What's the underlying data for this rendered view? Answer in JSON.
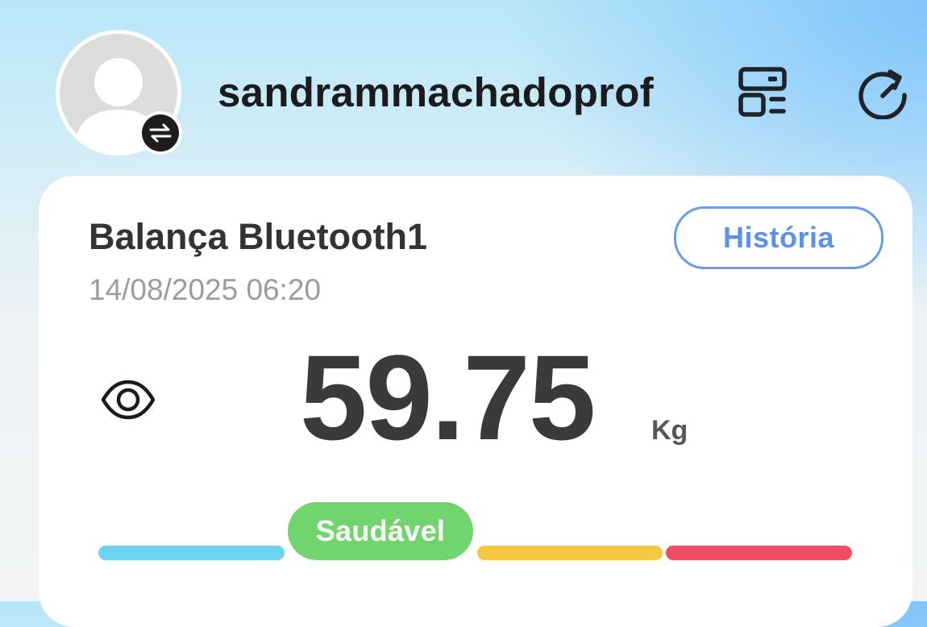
{
  "header": {
    "username": "sandrammachadoprof",
    "avatar_icon": "default-user-avatar-icon",
    "switch_icon": "switch-arrows-icon",
    "device_icon": "device-list-icon",
    "refresh_icon": "refresh-icon"
  },
  "card": {
    "device_name": "Balança Bluetooth1",
    "history_label": "História",
    "timestamp": "14/08/2025 06:20",
    "visibility_icon": "eye-icon",
    "weight": "59.75",
    "unit": "Kg",
    "status": {
      "label": "Saudável",
      "active_segment": 2,
      "segment_colors": [
        "#6bd4f0",
        "#6fd56c",
        "#f5c842",
        "#f04c64"
      ]
    }
  },
  "colors": {
    "accent_blue": "#5d92e6",
    "healthy_green": "#6fd56c",
    "text_dark": "#333336",
    "text_muted": "#9c9c9e"
  }
}
